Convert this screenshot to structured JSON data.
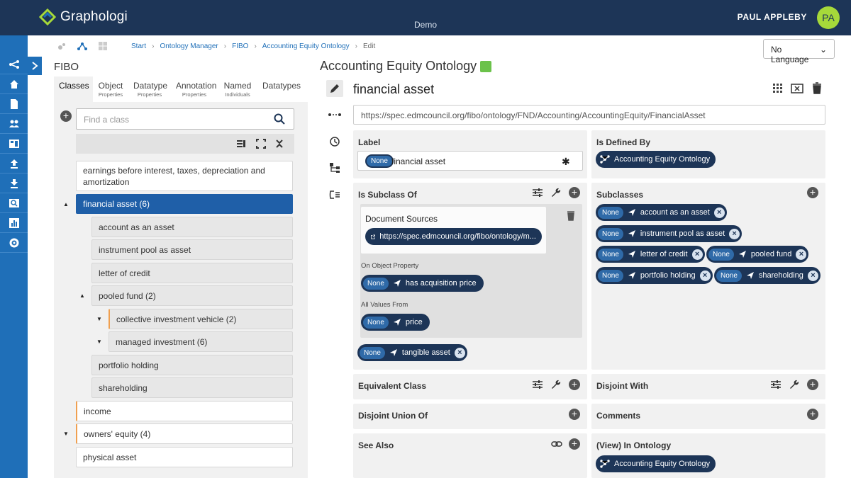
{
  "app": {
    "name": "Graphologi",
    "project": "Demo",
    "user": "PAUL APPLEBY",
    "initials": "PA",
    "language": "No Language"
  },
  "breadcrumb": [
    "Start",
    "Ontology Manager",
    "FIBO",
    "Accounting Equity Ontology",
    "Edit"
  ],
  "left": {
    "heading": "FIBO",
    "tabs": [
      {
        "label": "Classes",
        "sub": ""
      },
      {
        "label": "Object",
        "sub": "Properties"
      },
      {
        "label": "Datatype",
        "sub": "Properties"
      },
      {
        "label": "Annotation",
        "sub": "Properties"
      },
      {
        "label": "Named",
        "sub": "Individuals"
      },
      {
        "label": "Datatypes",
        "sub": ""
      }
    ],
    "search_placeholder": "Find a class",
    "tree": [
      "earnings before interest, taxes, depreciation and amortization",
      "financial asset (6)",
      "account as an asset",
      "instrument pool as asset",
      "letter of credit",
      "pooled fund (2)",
      "collective investment vehicle (2)",
      "managed investment (6)",
      "portfolio holding",
      "shareholding",
      "income",
      "owners' equity (4)",
      "physical asset"
    ]
  },
  "main": {
    "ontology_title": "Accounting Equity Ontology",
    "class_name": "financial asset",
    "iri": "https://spec.edmcouncil.org/fibo/ontology/FND/Accounting/AccountingEquity/FinancialAsset",
    "label": {
      "title": "Label",
      "lang": "None",
      "value": "financial asset"
    },
    "defined_by": {
      "title": "Is Defined By",
      "value": "Accounting Equity Ontology"
    },
    "subclass_of": {
      "title": "Is Subclass Of",
      "doc_sources_title": "Document Sources",
      "doc_source": "https://spec.edmcouncil.org/fibo/ontology/m...",
      "on_prop_label": "On Object Property",
      "on_prop": {
        "lang": "None",
        "value": "has acquisition price"
      },
      "all_values_label": "All Values From",
      "all_values": {
        "lang": "None",
        "value": "price"
      },
      "extra": {
        "lang": "None",
        "value": "tangible asset"
      }
    },
    "subclasses": {
      "title": "Subclasses",
      "items": [
        {
          "lang": "None",
          "value": "account as an asset"
        },
        {
          "lang": "None",
          "value": "instrument pool as asset"
        },
        {
          "lang": "None",
          "value": "letter of credit"
        },
        {
          "lang": "None",
          "value": "pooled fund"
        },
        {
          "lang": "None",
          "value": "portfolio holding"
        },
        {
          "lang": "None",
          "value": "shareholding"
        }
      ]
    },
    "equivalent": "Equivalent Class",
    "disjoint": "Disjoint With",
    "disjoint_union": "Disjoint Union Of",
    "comments": "Comments",
    "see_also": "See Also",
    "in_ontology": {
      "title": "(View) In Ontology",
      "value": "Accounting Equity Ontology"
    }
  }
}
